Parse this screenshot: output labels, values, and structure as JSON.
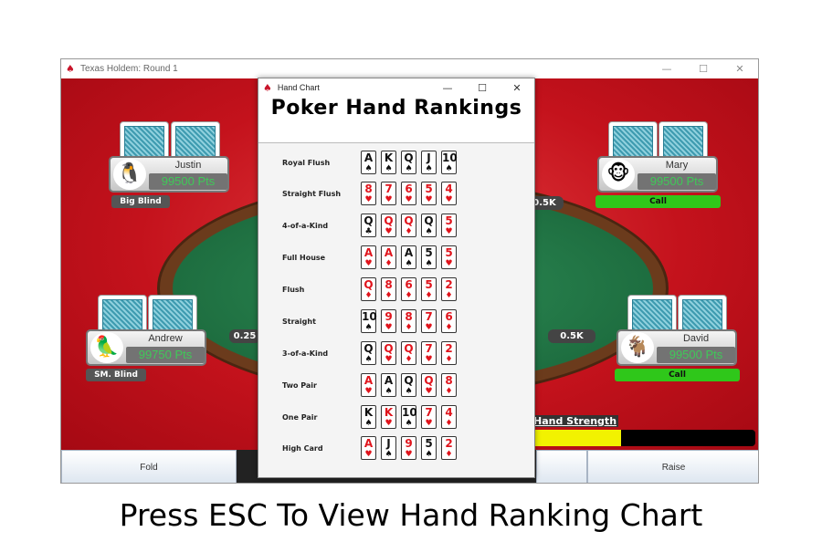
{
  "main_window": {
    "title": "Texas Holdem: Round 1",
    "controls": {
      "minimize": "—",
      "maximize": "☐",
      "close": "✕"
    }
  },
  "players": [
    {
      "name": "Justin",
      "points": "99500 Pts",
      "avatar_icon": "penguin-icon",
      "avatar_glyph": "🐧",
      "tag": "Big Blind"
    },
    {
      "name": "Mary",
      "points": "99500 Pts",
      "avatar_icon": "monkey-icon",
      "avatar_glyph": "🐵",
      "tag": "Call"
    },
    {
      "name": "Andrew",
      "points": "99750 Pts",
      "avatar_icon": "parrot-icon",
      "avatar_glyph": "🦜",
      "tag": "SM. Blind"
    },
    {
      "name": "David",
      "points": "99500 Pts",
      "avatar_icon": "goat-icon",
      "avatar_glyph": "🐐",
      "tag": "Call"
    }
  ],
  "bets": {
    "andrew": "0.25",
    "mary": "0.5K",
    "david": "0.5K"
  },
  "hand_strength": {
    "label": "Hand Strength",
    "level": 0.4,
    "color": "#f2f200"
  },
  "actions": {
    "fold": "Fold",
    "raise": "Raise"
  },
  "hand_chart": {
    "window_title": "Hand Chart",
    "controls": {
      "minimize": "—",
      "maximize": "☐",
      "close": "✕"
    },
    "heading": "Poker Hand Rankings",
    "rankings": [
      {
        "name": "Royal Flush",
        "cards": [
          [
            "A",
            "♠",
            "black"
          ],
          [
            "K",
            "♠",
            "black"
          ],
          [
            "Q",
            "♠",
            "black"
          ],
          [
            "J",
            "♠",
            "black"
          ],
          [
            "10",
            "♠",
            "black"
          ]
        ]
      },
      {
        "name": "Straight Flush",
        "cards": [
          [
            "8",
            "♥",
            "red"
          ],
          [
            "7",
            "♥",
            "red"
          ],
          [
            "6",
            "♥",
            "red"
          ],
          [
            "5",
            "♥",
            "red"
          ],
          [
            "4",
            "♥",
            "red"
          ]
        ]
      },
      {
        "name": "4-of-a-Kind",
        "cards": [
          [
            "Q",
            "♣",
            "black"
          ],
          [
            "Q",
            "♥",
            "red"
          ],
          [
            "Q",
            "♦",
            "red"
          ],
          [
            "Q",
            "♠",
            "black"
          ],
          [
            "5",
            "♥",
            "red"
          ]
        ]
      },
      {
        "name": "Full House",
        "cards": [
          [
            "A",
            "♥",
            "red"
          ],
          [
            "A",
            "♦",
            "red"
          ],
          [
            "A",
            "♠",
            "black"
          ],
          [
            "5",
            "♠",
            "black"
          ],
          [
            "5",
            "♥",
            "red"
          ]
        ]
      },
      {
        "name": "Flush",
        "cards": [
          [
            "Q",
            "♦",
            "red"
          ],
          [
            "8",
            "♦",
            "red"
          ],
          [
            "6",
            "♦",
            "red"
          ],
          [
            "5",
            "♦",
            "red"
          ],
          [
            "2",
            "♦",
            "red"
          ]
        ]
      },
      {
        "name": "Straight",
        "cards": [
          [
            "10",
            "♠",
            "black"
          ],
          [
            "9",
            "♥",
            "red"
          ],
          [
            "8",
            "♦",
            "red"
          ],
          [
            "7",
            "♥",
            "red"
          ],
          [
            "6",
            "♦",
            "red"
          ]
        ]
      },
      {
        "name": "3-of-a-Kind",
        "cards": [
          [
            "Q",
            "♠",
            "black"
          ],
          [
            "Q",
            "♥",
            "red"
          ],
          [
            "Q",
            "♦",
            "red"
          ],
          [
            "7",
            "♥",
            "red"
          ],
          [
            "2",
            "♦",
            "red"
          ]
        ]
      },
      {
        "name": "Two Pair",
        "cards": [
          [
            "A",
            "♥",
            "red"
          ],
          [
            "A",
            "♠",
            "black"
          ],
          [
            "Q",
            "♠",
            "black"
          ],
          [
            "Q",
            "♥",
            "red"
          ],
          [
            "8",
            "♦",
            "red"
          ]
        ]
      },
      {
        "name": "One Pair",
        "cards": [
          [
            "K",
            "♠",
            "black"
          ],
          [
            "K",
            "♥",
            "red"
          ],
          [
            "10",
            "♠",
            "black"
          ],
          [
            "7",
            "♥",
            "red"
          ],
          [
            "4",
            "♦",
            "red"
          ]
        ]
      },
      {
        "name": "High Card",
        "cards": [
          [
            "A",
            "♥",
            "red"
          ],
          [
            "J",
            "♠",
            "black"
          ],
          [
            "9",
            "♥",
            "red"
          ],
          [
            "5",
            "♠",
            "black"
          ],
          [
            "2",
            "♦",
            "red"
          ]
        ]
      }
    ]
  },
  "caption": "Press ESC To View Hand Ranking Chart",
  "colors": {
    "table_red": "#c4121c",
    "felt_green": "#1e6e40",
    "points_green": "#3fc958",
    "call_green": "#2fc71a"
  }
}
